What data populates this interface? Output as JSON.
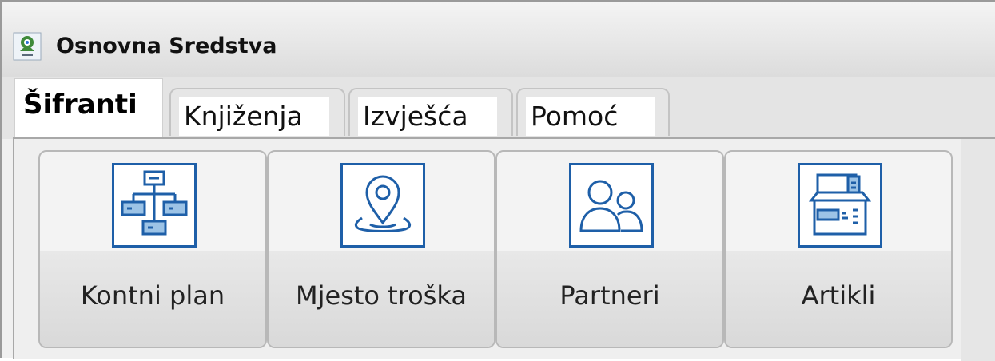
{
  "window": {
    "title": "Osnovna Sredstva",
    "icon": "app-logo-icon"
  },
  "tabs": {
    "active_index": 0,
    "items": [
      {
        "label": "Šifranti"
      },
      {
        "label": "Knjiženja"
      },
      {
        "label": "Izvješća"
      },
      {
        "label": "Pomoć"
      }
    ]
  },
  "ribbon": {
    "buttons": [
      {
        "label": "Kontni plan",
        "icon": "org-chart-icon"
      },
      {
        "label": "Mjesto troška",
        "icon": "location-pin-icon"
      },
      {
        "label": "Partneri",
        "icon": "users-icon"
      },
      {
        "label": "Artikli",
        "icon": "box-icon"
      }
    ]
  },
  "colors": {
    "icon_stroke": "#1e5fa8",
    "icon_accent": "#9cc3e6"
  }
}
